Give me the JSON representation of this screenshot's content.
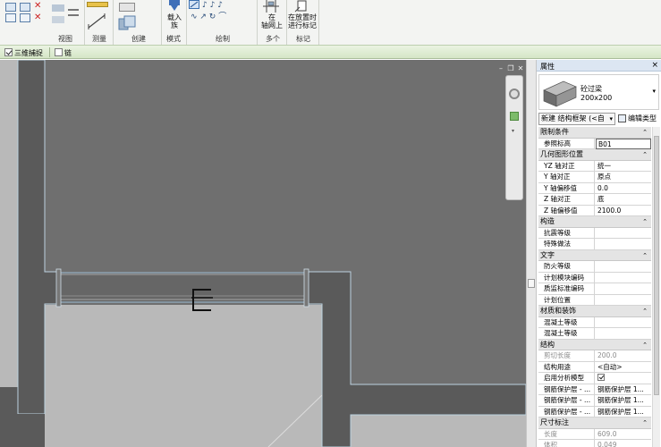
{
  "ribbon": {
    "groups": [
      {
        "id": "view",
        "label": "视图"
      },
      {
        "id": "measure",
        "label": "测量"
      },
      {
        "id": "create",
        "label": "创建"
      },
      {
        "id": "mode",
        "label": "模式"
      },
      {
        "id": "draw",
        "label": "绘制"
      },
      {
        "id": "multiple",
        "label": "多个"
      },
      {
        "id": "tag",
        "label": "标记"
      }
    ],
    "buttons": {
      "load_family": "载入\n族",
      "on_grid": "在\n轴网上",
      "tag_on_place": "在放置时\n进行标记"
    }
  },
  "options": {
    "three_d_snap_label": "三维捕捉",
    "three_d_snap_checked": true,
    "chain_label": "链",
    "chain_checked": false
  },
  "view": {
    "controls": [
      "minimize",
      "restore",
      "close"
    ]
  },
  "properties": {
    "title": "属性",
    "close_label": "×",
    "type_name": "砼过梁",
    "type_size": "200x200",
    "instance_selector": "新建 结构框架 (<自",
    "edit_type_label": "编辑类型",
    "sections": [
      {
        "title": "限制条件",
        "rows": [
          {
            "key": "参照标高",
            "value": "B01",
            "input": true
          }
        ]
      },
      {
        "title": "几何图形位置",
        "rows": [
          {
            "key": "YZ 轴对正",
            "value": "统一"
          },
          {
            "key": "Y 轴对正",
            "value": "原点"
          },
          {
            "key": "Y 轴偏移值",
            "value": "0.0"
          },
          {
            "key": "Z 轴对正",
            "value": "底"
          },
          {
            "key": "Z 轴偏移值",
            "value": "2100.0"
          }
        ]
      },
      {
        "title": "构造",
        "rows": [
          {
            "key": "抗震等级",
            "value": ""
          },
          {
            "key": "特殊做法",
            "value": ""
          }
        ]
      },
      {
        "title": "文字",
        "rows": [
          {
            "key": "防火等级",
            "value": ""
          },
          {
            "key": "计划模块编码",
            "value": ""
          },
          {
            "key": "质监标准编码",
            "value": ""
          },
          {
            "key": "计划位置",
            "value": ""
          }
        ]
      },
      {
        "title": "材质和装饰",
        "rows": [
          {
            "key": "混凝土等级",
            "value": ""
          },
          {
            "key": "混凝土等级",
            "value": ""
          }
        ]
      },
      {
        "title": "结构",
        "rows": [
          {
            "key": "剪切长度",
            "value": "200.0",
            "dim": true
          },
          {
            "key": "结构用途",
            "value": "<自动>"
          },
          {
            "key": "启用分析模型",
            "value": "",
            "checkbox": true
          },
          {
            "key": "钢筋保护层 - ...",
            "value": "钢筋保护层 1..."
          },
          {
            "key": "钢筋保护层 - ...",
            "value": "钢筋保护层 1..."
          },
          {
            "key": "钢筋保护层 - ...",
            "value": "钢筋保护层 1..."
          }
        ]
      },
      {
        "title": "尺寸标注",
        "rows": [
          {
            "key": "长度",
            "value": "609.0",
            "dim": true
          },
          {
            "key": "体积",
            "value": "0.049",
            "dim": true
          }
        ]
      }
    ]
  },
  "colors": {
    "view_bg": "#6f6f6f",
    "wall_fill": "#5a5a5a",
    "floor_fill": "#b9b9b9",
    "ribbon_bg": "#f3f4f2",
    "options_bar": "#dbe9cf",
    "properties_header": "#dce6f2"
  }
}
